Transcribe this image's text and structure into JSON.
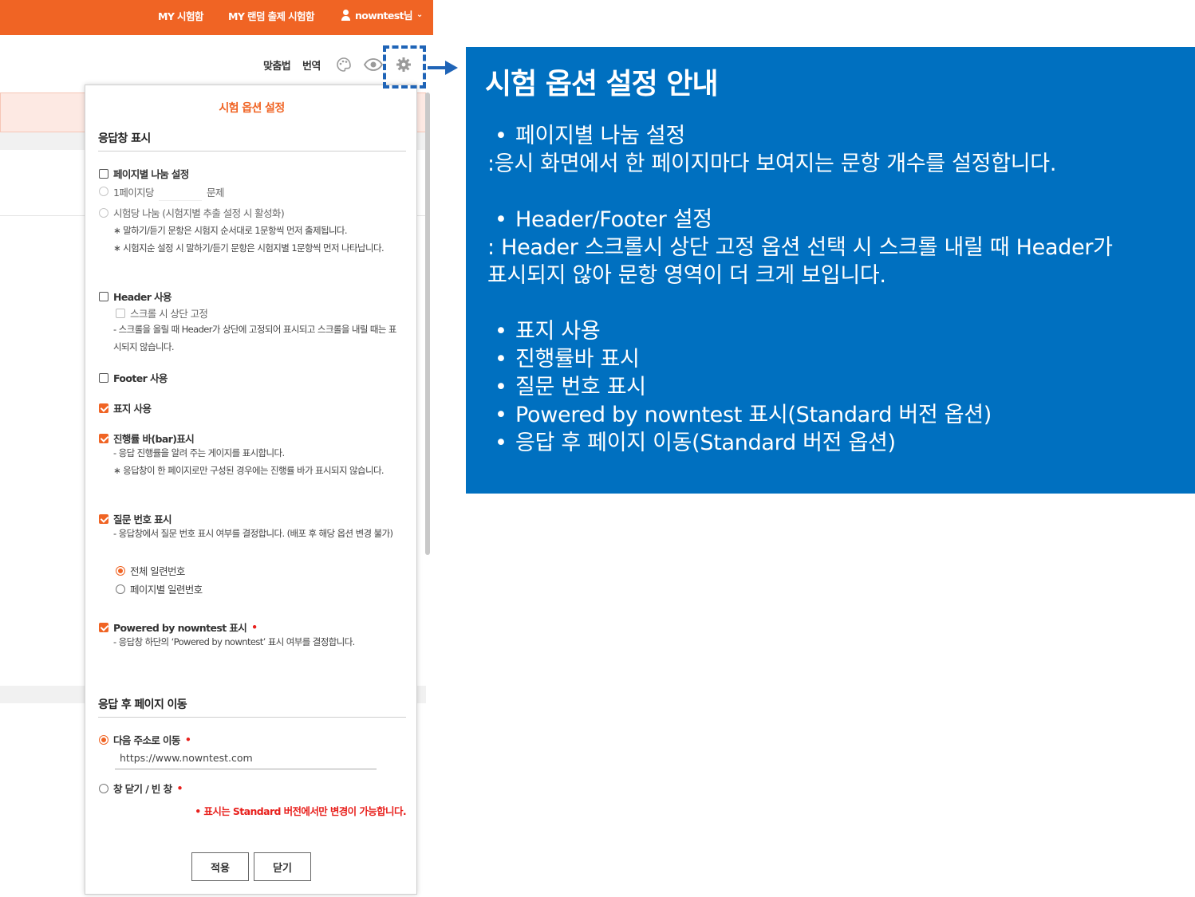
{
  "topbar": {
    "nav": [
      "MY 시험함",
      "MY 랜덤 출제 시험함"
    ],
    "user": "nowntest님",
    "user_chevron": "⌄"
  },
  "toolbar": {
    "spellcheck": "맞춤법",
    "translate": "번역",
    "icons": [
      "palette-icon",
      "eye-icon",
      "gear-icon"
    ]
  },
  "modal": {
    "title": "시험 옵션 설정",
    "section1": "응답창 표시",
    "page_split": {
      "label": "페이지별 나눔 설정",
      "per_page_prefix": "1페이지당",
      "per_page_suffix": "문제",
      "per_exam": "시험당 나눔 (시험지별 추출 설정 시 활성화)",
      "note1": "∗ 말하기/듣기 문항은 시험지 순서대로 1문항씩 먼저 출제됩니다.",
      "note2": "∗ 시험지순 설정 시 말하기/듣기 문항은 시험지별 1문항씩 먼저 나타납니다."
    },
    "header": {
      "label": "Header 사용",
      "sticky": "스크롤 시 상단 고정",
      "note": "- 스크롤을 올릴 때 Header가 상단에 고정되어 표시되고 스크롤을 내릴 때는 표시되지 않습니다."
    },
    "footer": {
      "label": "Footer 사용"
    },
    "cover": {
      "label": "표지 사용"
    },
    "progress": {
      "label": "진행률 바(bar)표시",
      "note1": "- 응답 진행률을 알려 주는 게이지를 표시합니다.",
      "note2": "∗ 응답창이 한 페이지로만 구성된 경우에는 진행률 바가 표시되지 않습니다."
    },
    "qnum": {
      "label": "질문 번호 표시",
      "note": "- 응답창에서 질문 번호 표시 여부를 결정합니다. (배포 후 해당 옵션 변경 불가)",
      "opt_all": "전체 일련번호",
      "opt_page": "페이지별 일련번호"
    },
    "powered": {
      "label": "Powered by nowntest 표시",
      "req": "•",
      "note": "- 응답창 하단의 ‘Powered by nowntest’ 표시 여부를 결정합니다."
    },
    "section2": "응답 후 페이지 이동",
    "after": {
      "next_url": "다음 주소로 이동",
      "url_value": "https://www.nowntest.com",
      "close": "창 닫기 / 빈 창",
      "req": "•"
    },
    "warning": "• 표시는 Standard 버전에서만 변경이 가능합니다.",
    "apply": "적용",
    "close_btn": "닫기"
  },
  "panel": {
    "title": "시험 옵션 설정 안내",
    "bullet_char": "•",
    "b1": "페이지별 나눔 설정",
    "d1": ":응시 화면에서 한 페이지마다 보여지는 문항 개수를 설정합니다.",
    "b2": "Header/Footer 설정",
    "d2a": ": Header 스크롤시 상단 고정 옵션 선택 시 스크롤 내릴 때 Header가",
    "d2b": "표시되지 않아 문항 영역이 더 크게 보입니다.",
    "list": [
      "표지 사용",
      "진행률바 표시",
      "질문 번호 표시",
      "Powered by nowntest 표시(Standard 버전 옵션)",
      "응답 후 페이지 이동(Standard 버전 옵션)"
    ]
  },
  "colors": {
    "brand_orange": "#f06424",
    "panel_blue": "#0070c0",
    "highlight_blue": "#1f64b7",
    "required_red": "#e8211d"
  }
}
